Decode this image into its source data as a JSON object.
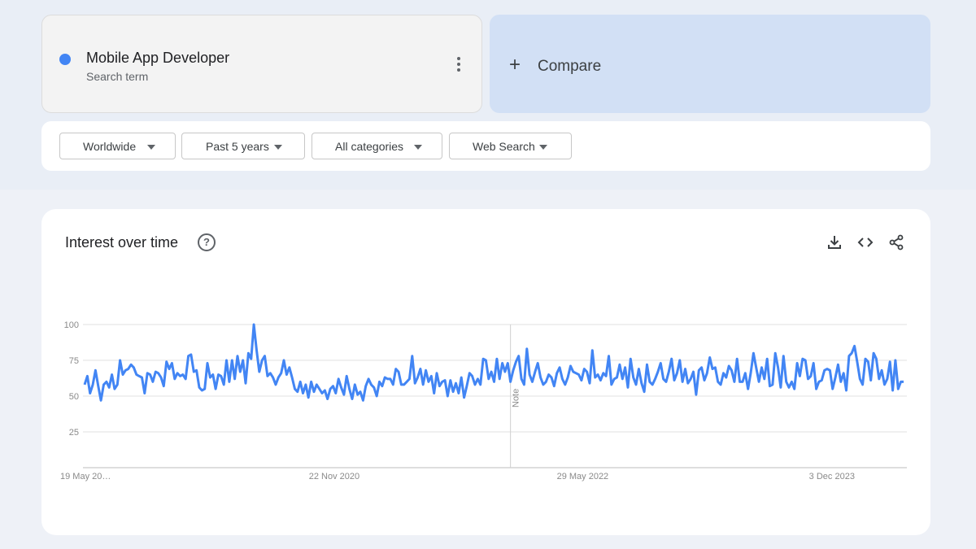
{
  "search_term": {
    "name": "Mobile App Developer",
    "subtitle": "Search term",
    "color": "#4285f4"
  },
  "compare": {
    "label": "Compare"
  },
  "filters": [
    {
      "label": "Worldwide"
    },
    {
      "label": "Past 5 years"
    },
    {
      "label": "All categories"
    },
    {
      "label": "Web Search"
    }
  ],
  "card": {
    "title": "Interest over time",
    "help_icon": "?",
    "tools": [
      "download-icon",
      "embed-code-icon",
      "share-icon"
    ]
  },
  "chart_data": {
    "type": "line",
    "title": "",
    "xlabel": "",
    "ylabel": "",
    "ylim": [
      0,
      100
    ],
    "yticks": [
      25,
      50,
      75,
      100
    ],
    "x_tick_labels": [
      "19 May 20…",
      "22 Nov 2020",
      "29 May 2022",
      "3 Dec 2023"
    ],
    "annotation": "Note",
    "grid": true,
    "series": [
      {
        "color": "#4285f4",
        "values": [
          58,
          64,
          52,
          58,
          68,
          57,
          47,
          58,
          60,
          56,
          65,
          55,
          58,
          75,
          65,
          68,
          69,
          72,
          70,
          65,
          64,
          63,
          52,
          66,
          65,
          60,
          67,
          66,
          63,
          57,
          74,
          69,
          73,
          62,
          66,
          64,
          65,
          62,
          78,
          79,
          67,
          68,
          56,
          54,
          55,
          73,
          63,
          65,
          55,
          65,
          64,
          58,
          75,
          60,
          75,
          62,
          78,
          67,
          75,
          59,
          80,
          76,
          100,
          82,
          67,
          75,
          78,
          64,
          66,
          63,
          58,
          63,
          66,
          75,
          65,
          70,
          63,
          55,
          53,
          60,
          52,
          58,
          49,
          60,
          53,
          58,
          55,
          52,
          54,
          48,
          55,
          57,
          52,
          62,
          56,
          51,
          64,
          55,
          48,
          58,
          51,
          53,
          47,
          57,
          62,
          58,
          56,
          50,
          60,
          57,
          63,
          62,
          62,
          58,
          69,
          67,
          58,
          58,
          60,
          62,
          78,
          59,
          63,
          69,
          58,
          68,
          60,
          64,
          52,
          66,
          57,
          60,
          61,
          50,
          61,
          53,
          59,
          52,
          63,
          49,
          57,
          66,
          64,
          58,
          62,
          58,
          76,
          75,
          62,
          67,
          60,
          76,
          62,
          73,
          67,
          73,
          60,
          68,
          74,
          78,
          62,
          58,
          83,
          65,
          60,
          67,
          73,
          63,
          58,
          60,
          65,
          63,
          57,
          66,
          70,
          62,
          58,
          63,
          71,
          67,
          66,
          65,
          61,
          69,
          67,
          59,
          82,
          63,
          65,
          61,
          66,
          64,
          78,
          58,
          62,
          63,
          72,
          62,
          70,
          56,
          76,
          63,
          58,
          69,
          59,
          53,
          72,
          60,
          58,
          62,
          67,
          73,
          62,
          60,
          67,
          76,
          61,
          66,
          75,
          60,
          69,
          59,
          62,
          67,
          51,
          68,
          70,
          61,
          66,
          77,
          69,
          70,
          60,
          58,
          66,
          63,
          71,
          68,
          60,
          76,
          60,
          60,
          66,
          55,
          66,
          80,
          70,
          60,
          70,
          62,
          76,
          57,
          58,
          80,
          70,
          56,
          78,
          60,
          56,
          60,
          55,
          73,
          64,
          76,
          75,
          62,
          64,
          73,
          55,
          60,
          61,
          68,
          69,
          68,
          55,
          63,
          72,
          60,
          66,
          54,
          78,
          80,
          85,
          74,
          62,
          58,
          76,
          74,
          61,
          80,
          76,
          62,
          68,
          58,
          62,
          74,
          54,
          75,
          55,
          60,
          60
        ]
      }
    ]
  }
}
